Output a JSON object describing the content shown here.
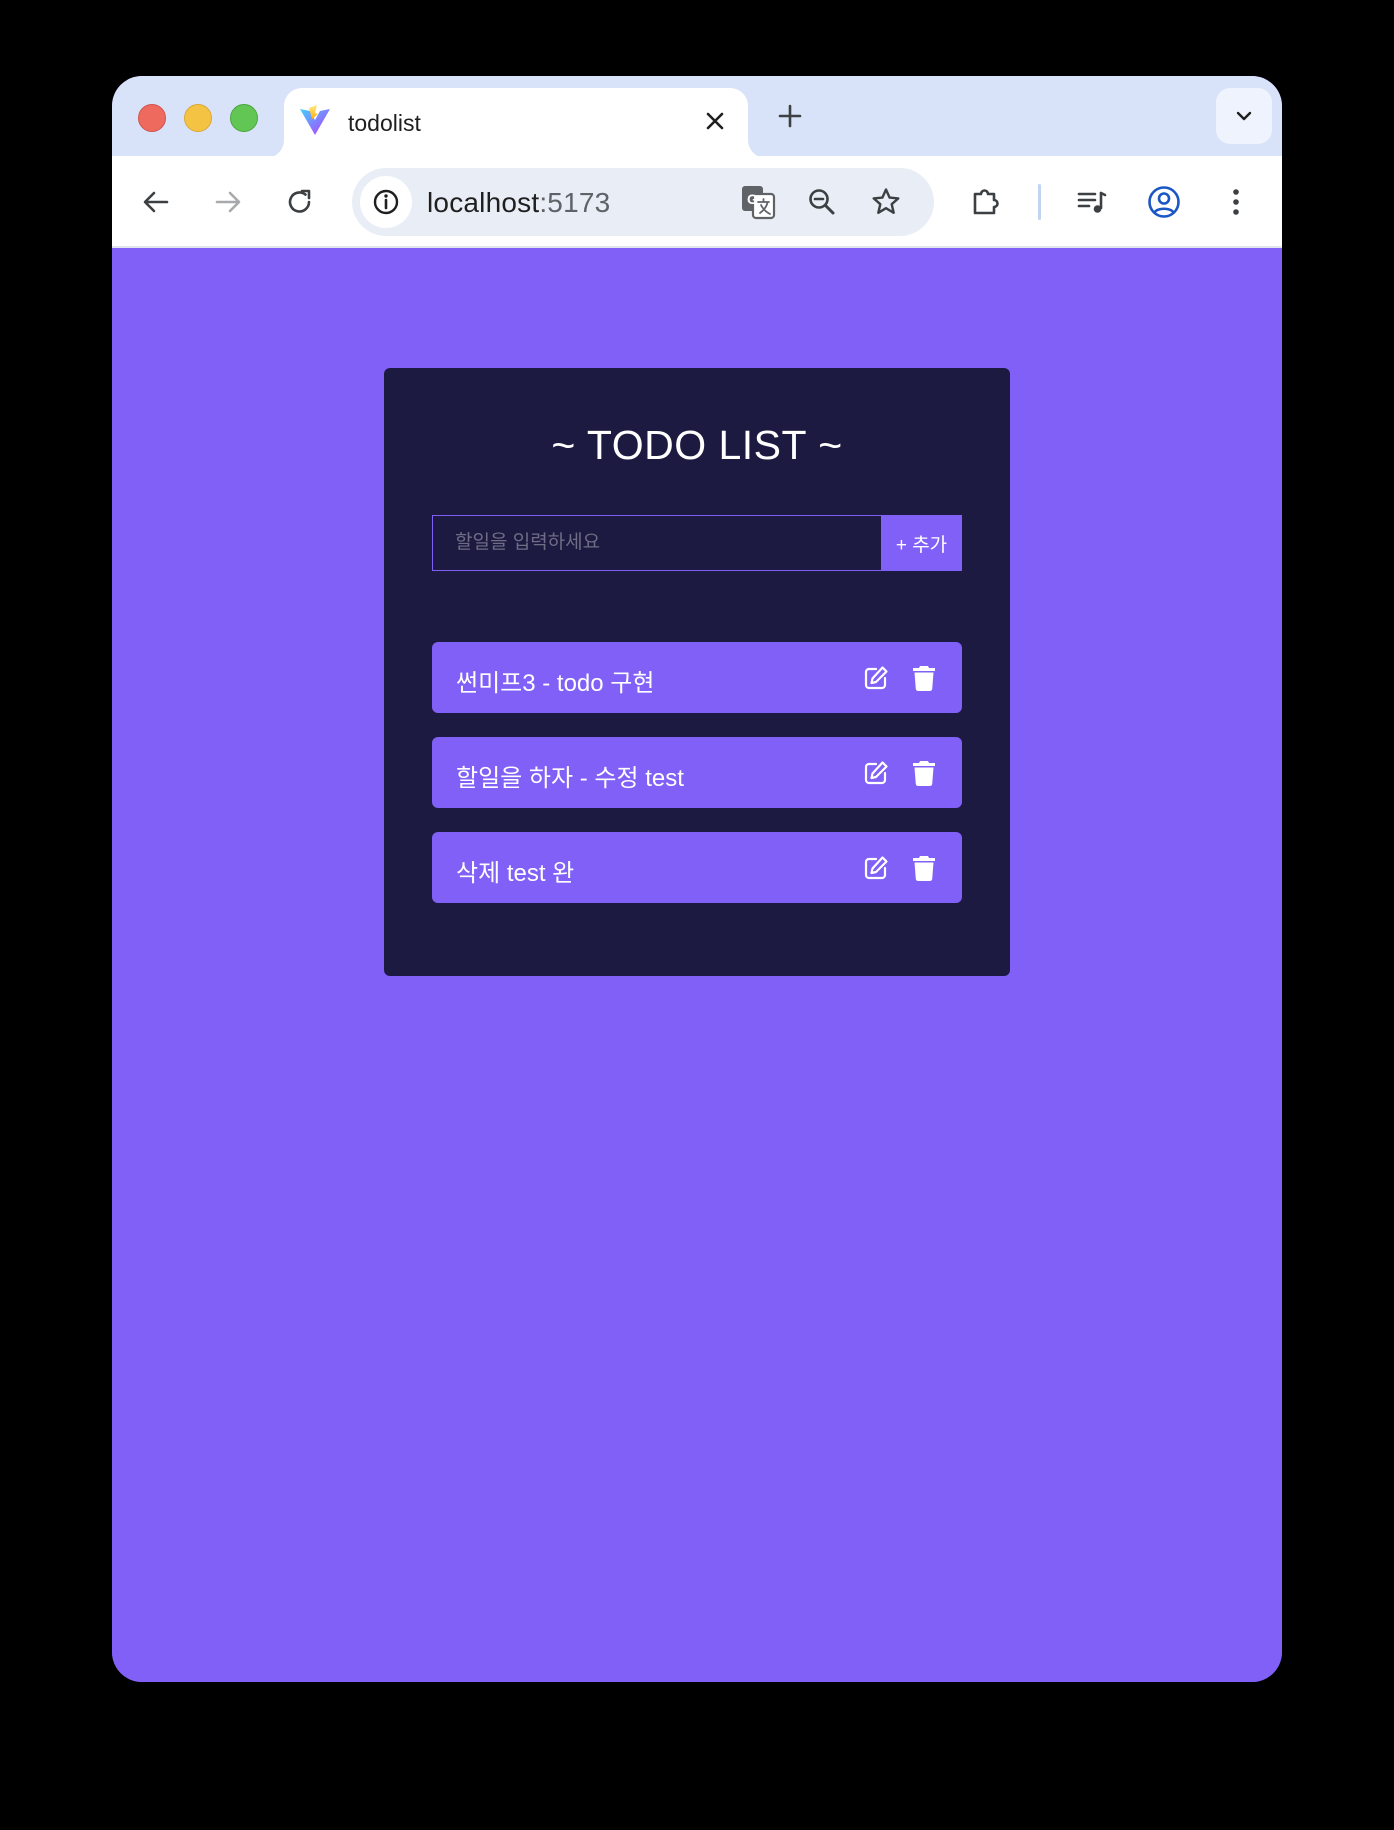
{
  "browser": {
    "tab": {
      "title": "todolist",
      "favicon": "vite-logo-icon"
    },
    "address_bar": {
      "host": "localhost",
      "port": ":5173"
    },
    "colors": {
      "titlebar": "#d8e3fa",
      "omnibox": "#e9eef6",
      "profile_accent": "#1a56c4"
    }
  },
  "app": {
    "title": "~ TODO LIST ~",
    "input": {
      "placeholder": "할일을 입력하세요",
      "value": ""
    },
    "add_button_label": "+ 추가",
    "todos": [
      {
        "text": "썬미프3 - todo 구현"
      },
      {
        "text": "할일을 하자 - 수정 test"
      },
      {
        "text": "삭제 test 완"
      }
    ],
    "colors": {
      "background": "#8060f6",
      "card": "#1c1a40",
      "item": "#8060f6",
      "text": "#ffffff"
    }
  }
}
